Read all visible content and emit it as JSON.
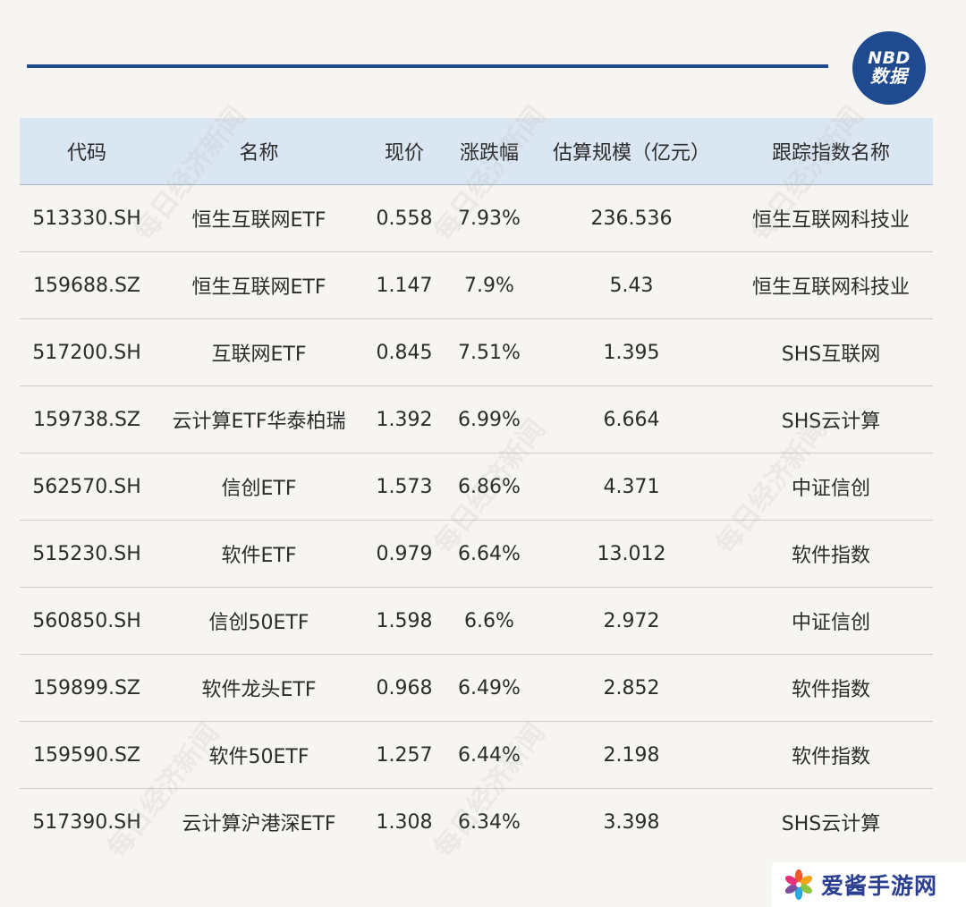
{
  "badge": {
    "line1": "NBD",
    "line2": "数据"
  },
  "watermark_text": "每日经济新闻",
  "table": {
    "headers": [
      "代码",
      "名称",
      "现价",
      "涨跌幅",
      "估算规模（亿元）",
      "跟踪指数名称"
    ],
    "rows": [
      [
        "513330.SH",
        "恒生互联网ETF",
        "0.558",
        "7.93%",
        "236.536",
        "恒生互联网科技业"
      ],
      [
        "159688.SZ",
        "恒生互联网ETF",
        "1.147",
        "7.9%",
        "5.43",
        "恒生互联网科技业"
      ],
      [
        "517200.SH",
        "互联网ETF",
        "0.845",
        "7.51%",
        "1.395",
        "SHS互联网"
      ],
      [
        "159738.SZ",
        "云计算ETF华泰柏瑞",
        "1.392",
        "6.99%",
        "6.664",
        "SHS云计算"
      ],
      [
        "562570.SH",
        "信创ETF",
        "1.573",
        "6.86%",
        "4.371",
        "中证信创"
      ],
      [
        "515230.SH",
        "软件ETF",
        "0.979",
        "6.64%",
        "13.012",
        "软件指数"
      ],
      [
        "560850.SH",
        "信创50ETF",
        "1.598",
        "6.6%",
        "2.972",
        "中证信创"
      ],
      [
        "159899.SZ",
        "软件龙头ETF",
        "0.968",
        "6.49%",
        "2.852",
        "软件指数"
      ],
      [
        "159590.SZ",
        "软件50ETF",
        "1.257",
        "6.44%",
        "2.198",
        "软件指数"
      ],
      [
        "517390.SH",
        "云计算沪港深ETF",
        "1.308",
        "6.34%",
        "3.398",
        "SHS云计算"
      ]
    ]
  },
  "brand": {
    "name": "爱酱手游网"
  },
  "colors": {
    "accent": "#1f4a8f",
    "header_bg": "#dbe6f3",
    "background": "#f7f5f1"
  }
}
